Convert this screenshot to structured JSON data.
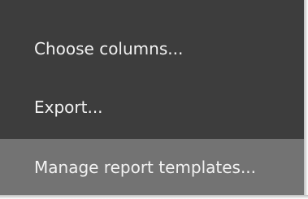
{
  "context_menu": {
    "items": [
      {
        "label": "Choose columns...",
        "highlighted": false
      },
      {
        "label": "Export...",
        "highlighted": false
      },
      {
        "label": "Manage report templates...",
        "highlighted": true
      }
    ],
    "colors": {
      "background": "#3d3d3d",
      "highlight": "#737373",
      "text": "#f2f2f2"
    }
  }
}
